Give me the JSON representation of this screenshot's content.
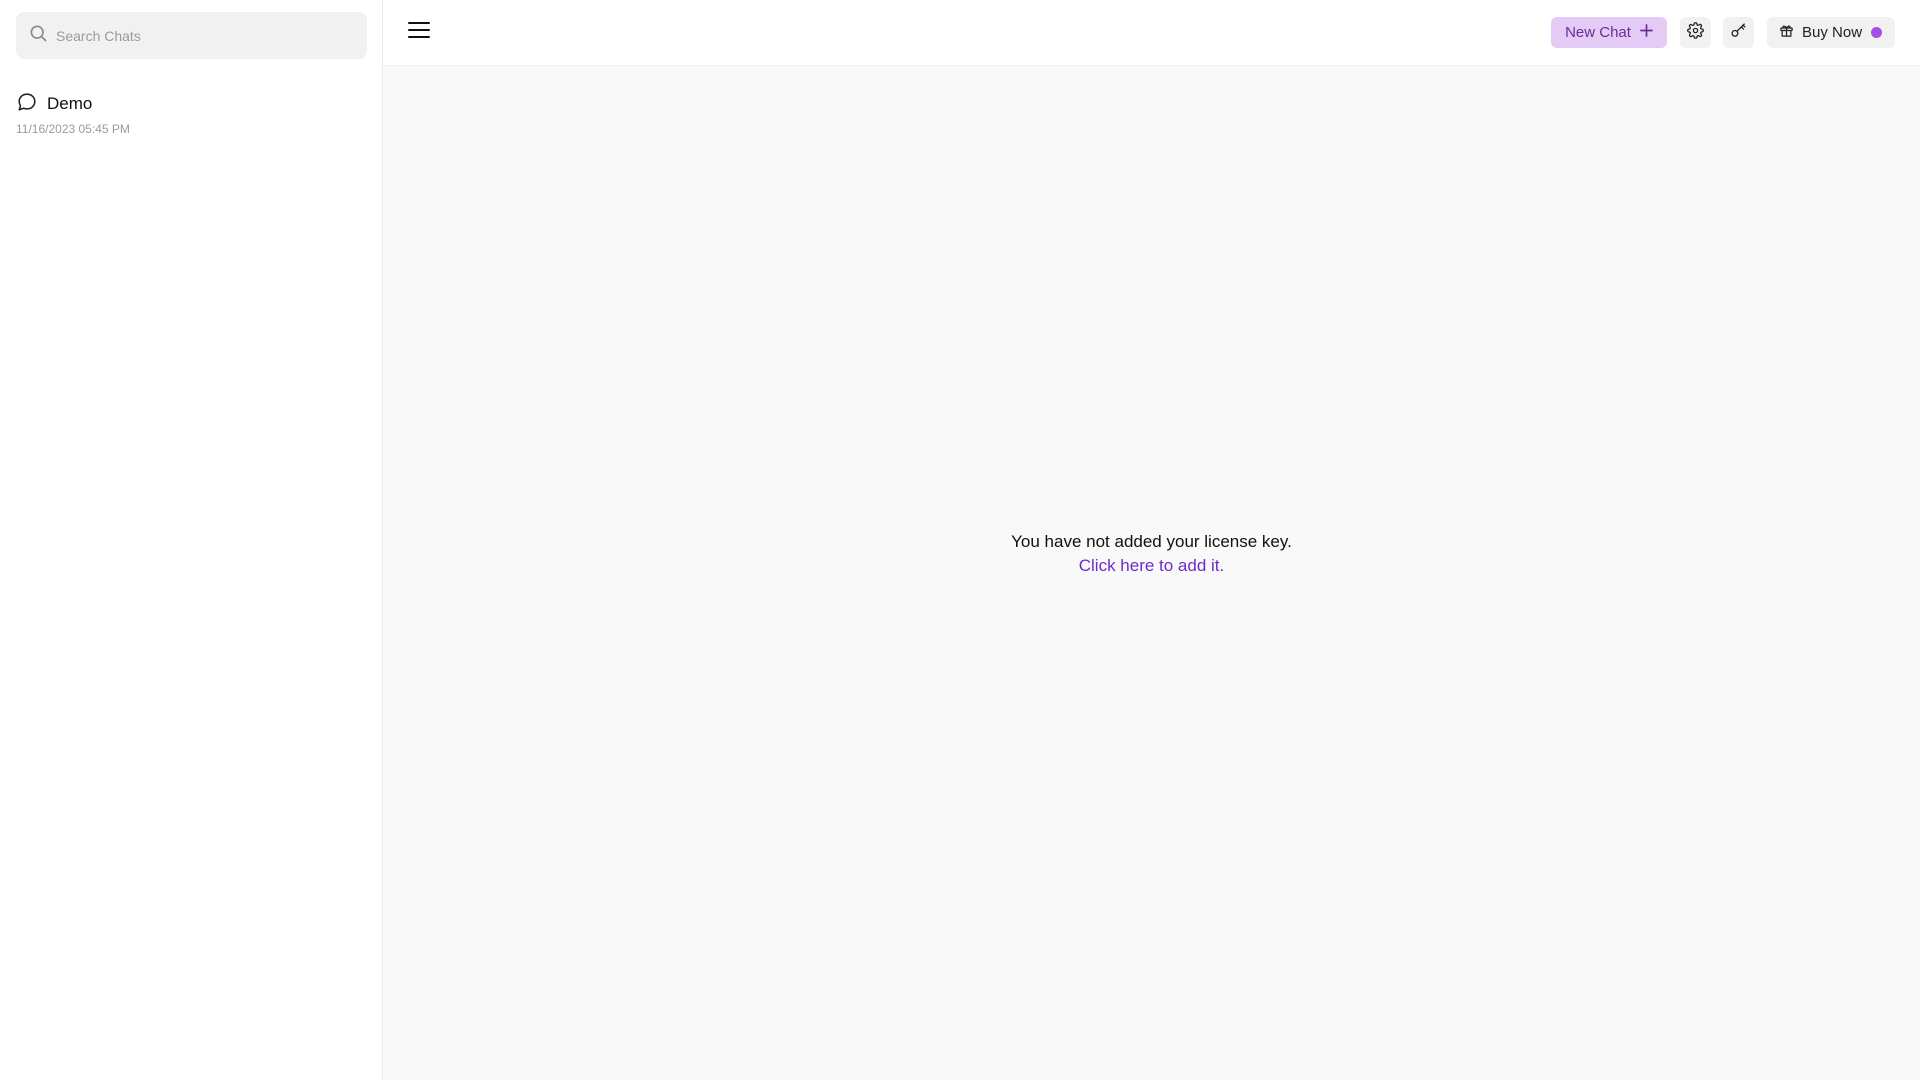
{
  "sidebar": {
    "search": {
      "placeholder": "Search Chats",
      "value": ""
    },
    "chats": [
      {
        "title": "Demo",
        "date": "11/16/2023 05:45 PM",
        "icon": "chat-bubble-icon"
      }
    ]
  },
  "topbar": {
    "menu_icon": "hamburger-menu-icon",
    "new_chat_label": "New Chat",
    "new_chat_icon": "plus-icon",
    "settings_icon": "gear-icon",
    "key_icon": "key-icon",
    "buy_now_label": "Buy Now",
    "buy_now_icon": "gift-icon"
  },
  "main": {
    "notice_text": "You have not added your license key.",
    "notice_link": "Click here to add it."
  },
  "colors": {
    "accent_bg": "#e3cbf6",
    "accent_text": "#6a2c96",
    "link": "#6b2dc8",
    "status_dot": "#a64de5"
  }
}
